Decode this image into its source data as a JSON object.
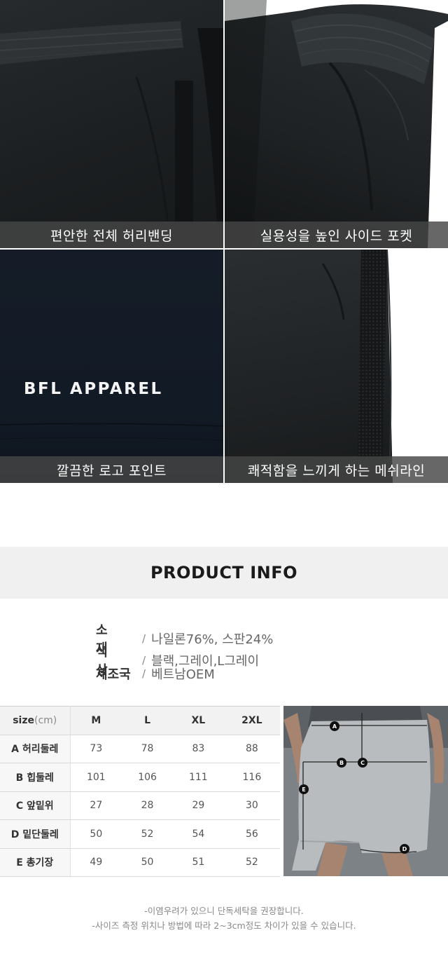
{
  "features": [
    {
      "caption": "편안한 전체 허리밴딩",
      "photo_icon": "waistband-photo"
    },
    {
      "caption": "실용성을 높인 사이드 포켓",
      "photo_icon": "side-pocket-photo"
    },
    {
      "caption": "깔끔한 로고 포인트",
      "photo_icon": "logo-photo",
      "logo_text": "BFL APPAREL"
    },
    {
      "caption": "쾌적함을 느끼게 하는 메쉬라인",
      "photo_icon": "mesh-line-photo"
    }
  ],
  "product_info": {
    "title": "PRODUCT INFO",
    "specs": [
      {
        "label": "소 재",
        "value": "나일론76%, 스판24%"
      },
      {
        "label": "색 상",
        "value": "블랙,그레이,L그레이"
      },
      {
        "label": "제조국",
        "value": "베트남OEM"
      }
    ],
    "separator": "/"
  },
  "size_table": {
    "header_label": "size",
    "header_unit": "(cm)",
    "sizes": [
      "M",
      "L",
      "XL",
      "2XL"
    ],
    "rows": [
      {
        "label": "A 허리둘레",
        "values": [
          "73",
          "78",
          "83",
          "88"
        ]
      },
      {
        "label": "B 힙둘레",
        "values": [
          "101",
          "106",
          "111",
          "116"
        ]
      },
      {
        "label": "C 앞밑위",
        "values": [
          "27",
          "28",
          "29",
          "30"
        ]
      },
      {
        "label": "D 밑단둘레",
        "values": [
          "50",
          "52",
          "54",
          "56"
        ]
      },
      {
        "label": "E 총기장",
        "values": [
          "49",
          "50",
          "51",
          "52"
        ]
      }
    ]
  },
  "measure_markers": [
    "A",
    "B",
    "C",
    "D",
    "E"
  ],
  "notes": [
    "-이염우려가 있으니 단독세탁을 권장합니다.",
    "-사이즈 측정 위치나 방법에 따라 2~3cm정도 차이가 있을 수 있습니다."
  ],
  "colors": {
    "caption_bg": "#464646",
    "info_band": "#f0f0f0",
    "table_header": "#f2f2f2"
  }
}
